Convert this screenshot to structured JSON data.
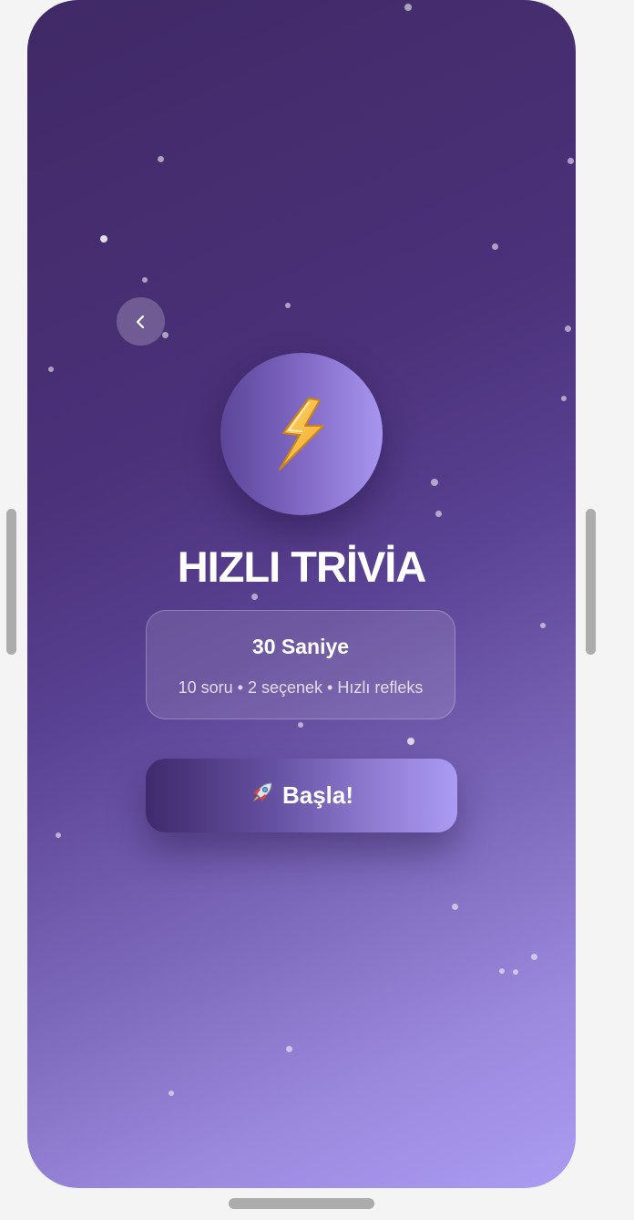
{
  "screen": {
    "title": "HIZLI TRİVİA",
    "hero_icon": "lightning-bolt-icon",
    "back_icon": "chevron-left-icon"
  },
  "info_card": {
    "title": "30 Saniye",
    "details": "10 soru • 2 seçenek • Hızlı refleks"
  },
  "start_button": {
    "icon": "rocket-icon",
    "label": "Başla!"
  },
  "colors": {
    "gradient_start": "#402966",
    "gradient_end": "#ab9cf2",
    "bolt": "#f6b93b"
  }
}
